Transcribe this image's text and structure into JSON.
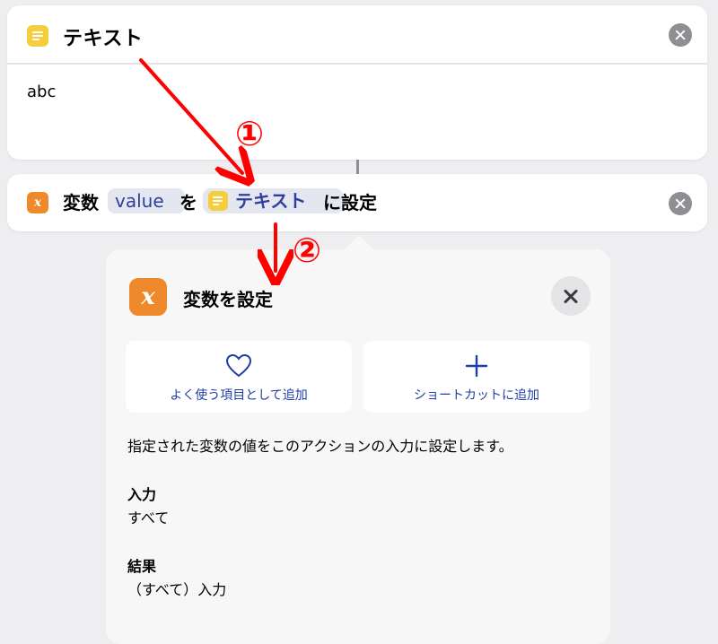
{
  "text_action": {
    "title": "テキスト",
    "icon": "text-icon",
    "content": "abc"
  },
  "set_variable_action": {
    "label_prefix": "変数",
    "variable_name": "value",
    "particle": "を",
    "input_token": "テキスト",
    "label_suffix": "に設定",
    "icon": "variable-icon"
  },
  "popover": {
    "title": "変数を設定",
    "favorite_label": "よく使う項目として追加",
    "add_shortcut_label": "ショートカットに追加",
    "description": "指定された変数の値をこのアクションの入力に設定します。",
    "input_heading": "入力",
    "input_value": "すべて",
    "result_heading": "結果",
    "result_value": "（すべて）入力"
  },
  "annotations": {
    "step1": "①",
    "step2": "②",
    "color": "#ff0000"
  },
  "colors": {
    "text_icon": "#f6cd3c",
    "variable_icon": "#ee8a2c",
    "token_text": "#2f3f9e",
    "link_blue": "#1f3ea8"
  }
}
